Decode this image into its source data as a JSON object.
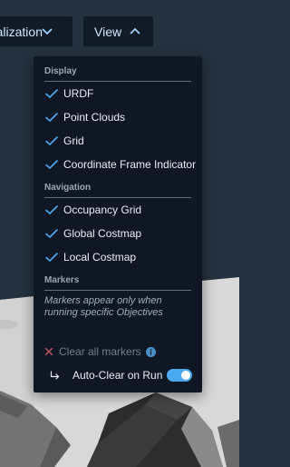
{
  "toolbar": {
    "visualization_label": "Visualization",
    "view_label": "View"
  },
  "view_menu": {
    "sections": {
      "display": "Display",
      "navigation": "Navigation",
      "markers": "Markers"
    },
    "display_items": [
      {
        "label": "URDF",
        "checked": true
      },
      {
        "label": "Point Clouds",
        "checked": true
      },
      {
        "label": "Grid",
        "checked": true
      },
      {
        "label": "Coordinate Frame Indicator",
        "checked": true
      }
    ],
    "navigation_items": [
      {
        "label": "Occupancy Grid",
        "checked": true
      },
      {
        "label": "Global Costmap",
        "checked": true
      },
      {
        "label": "Local Costmap",
        "checked": true
      }
    ],
    "markers_note": "Markers appear only when running specific Objectives",
    "clear_markers_label": "Clear all markers",
    "auto_clear_label": "Auto-Clear on Run",
    "auto_clear_enabled": true
  },
  "icons": {
    "check": "check-icon",
    "clear": "x-icon",
    "info": "info-icon",
    "return": "return-arrow-icon",
    "open_menu": "chevron-up-icon",
    "closed_menu": "chevron-down-icon"
  },
  "colors": {
    "accent": "#4aa8ee",
    "menu_bg": "#0e1723",
    "toolbar_bg": "#111b27",
    "viewport_bg": "#24313f",
    "ground": "#d9d9d9"
  }
}
